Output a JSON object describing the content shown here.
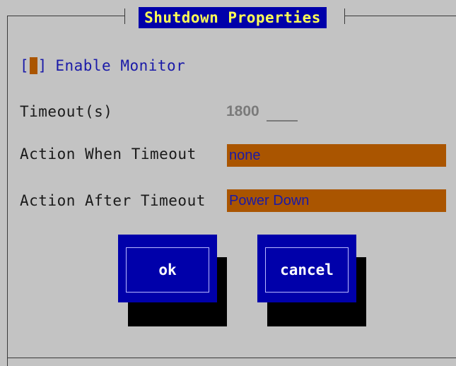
{
  "dialog": {
    "title": "Shutdown Properties"
  },
  "enable_monitor": {
    "label": "Enable Monitor",
    "checked": false,
    "bracket_open": "[",
    "bracket_close": "]"
  },
  "timeout": {
    "label": "Timeout(s)",
    "value": "1800"
  },
  "action_when_timeout": {
    "label": "Action When Timeout",
    "value": "none"
  },
  "action_after_timeout": {
    "label": "Action After Timeout",
    "value": "Power Down"
  },
  "buttons": {
    "ok_label": "ok",
    "cancel_label": "cancel"
  },
  "colors": {
    "background": "#c3c3c3",
    "button_face": "#0000aa",
    "title_text": "#ffff55",
    "field_bg": "#aa5500",
    "label_blue": "#1a1aa8"
  }
}
